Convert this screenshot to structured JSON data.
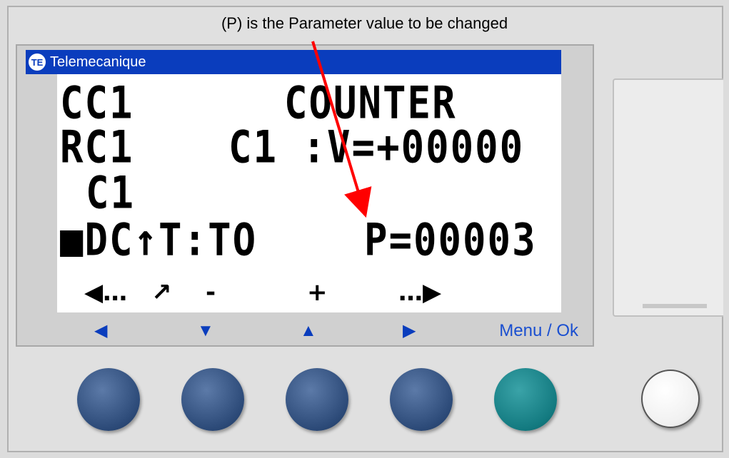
{
  "annotation": "(P) is the Parameter value to be changed",
  "brand": {
    "name": "Telemecanique",
    "logo_text": "TE"
  },
  "lcd": {
    "line1_left": "CC1",
    "line1_right": "COUNTER",
    "line2_left": "RC1",
    "line2_right": "C1 :V=+00000",
    "line3_left": "C1",
    "line4_left": "■DC↑T:TO",
    "line4_right": "P=00003"
  },
  "softkeys": {
    "left": "◀…",
    "mode": "↗",
    "minus": "-",
    "plus": "+",
    "right": "…▶"
  },
  "nav": {
    "left": "◀",
    "down": "▼",
    "up": "▲",
    "right": "▶",
    "menu_ok": "Menu / Ok"
  },
  "colors": {
    "brand_bar": "#0a3dbd",
    "nav_blue": "#0a3dbd",
    "button_blue": "#2c4a78",
    "button_ok": "#137a80",
    "annotation_arrow": "#ff0000"
  },
  "icons": {
    "brand_logo": "telemecanique-logo-icon",
    "annotation_arrow": "red-arrow-icon"
  }
}
